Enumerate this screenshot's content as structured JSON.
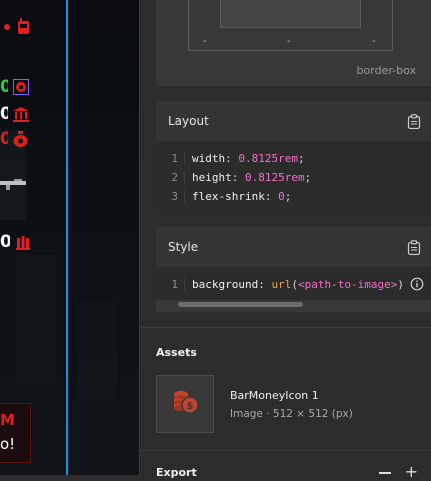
{
  "canvas": {
    "hud": {
      "row2_value": "0",
      "row3_value": "0",
      "row4_value": "0",
      "row6_value": "0",
      "label_line1": "M",
      "label_line2": "o!"
    },
    "icons": [
      "phone-icon",
      "inventory-icon",
      "bank-icon",
      "money-bag-icon",
      "rifle-icon",
      "ammo-icon"
    ]
  },
  "box_model": {
    "left": "-",
    "center": "-",
    "right": "-",
    "label": "border-box"
  },
  "layout": {
    "title": "Layout",
    "lines": [
      {
        "n": "1",
        "prop": "width",
        "value": "0.8125rem"
      },
      {
        "n": "2",
        "prop": "height",
        "value": "0.8125rem"
      },
      {
        "n": "3",
        "prop": "flex-shrink",
        "value": "0"
      }
    ]
  },
  "style": {
    "title": "Style",
    "line": {
      "n": "1",
      "prop": "background",
      "fn": "url",
      "arg": "<path-to-image>"
    }
  },
  "assets": {
    "title": "Assets",
    "item": {
      "name": "BarMoneyIcon 1",
      "meta": "Image · 512 × 512 (px)"
    }
  },
  "export": {
    "title": "Export"
  },
  "colors": {
    "accent_red": "#e01e1e",
    "hud_green": "#26d43a",
    "selection_blue": "#1a8fe3",
    "asset_icon": "#c4432c"
  }
}
